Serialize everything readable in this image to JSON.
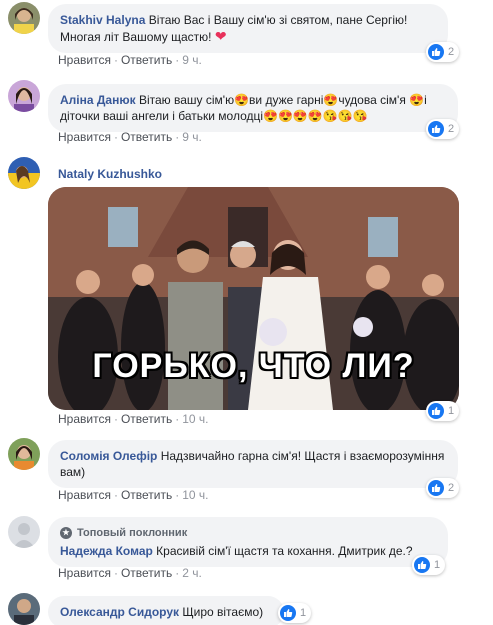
{
  "labels": {
    "like": "Нравится",
    "reply": "Ответить",
    "sep": "·"
  },
  "comments": [
    {
      "author": "Stakhiv Halyna",
      "text": "Вітаю Вас і Вашу сім'ю зі святом, пане Сергію! Многая літ Вашому щастю!",
      "time": "9 ч.",
      "reactions": "2"
    },
    {
      "author": "Аліна Данюк",
      "text_part1": "Вітаю вашу сім'ю",
      "text_part2": "ви дуже гарні",
      "text_part3": "чудова сім'я",
      "text_part4": "і діточки ваші ангели і батьки молодці",
      "time": "9 ч.",
      "reactions": "2"
    },
    {
      "author": "Nataly Kuzhushko",
      "gif_caption": "ГОРЬКО, ЧТО ЛИ?",
      "time": "10 ч.",
      "reactions": "1"
    },
    {
      "author": "Соломія Олефір",
      "text": "Надзвичайно гарна сім'я! Щастя і взаєморозуміння вам)",
      "time": "10 ч.",
      "reactions": "2"
    },
    {
      "badge": "Топовый поклонник",
      "author": "Надежда Комар",
      "text": "Красивій сім'ї щастя та кохання. Дмитрик де.?",
      "time": "2 ч.",
      "reactions": "1"
    },
    {
      "author": "Олександр Сидорук",
      "text": "Щиро вітаємо)",
      "reactions": "1"
    }
  ],
  "colors": {
    "name": "#385898",
    "like": "#1877f2",
    "bubble": "#f2f3f5",
    "heart": "#e8315b"
  },
  "icons": {
    "like": "thumbs-up-icon",
    "heart": "heart-emoji-icon",
    "heart_eyes": "heart-eyes-emoji-icon",
    "kiss": "kiss-emoji-icon",
    "fan": "star-badge-icon"
  }
}
